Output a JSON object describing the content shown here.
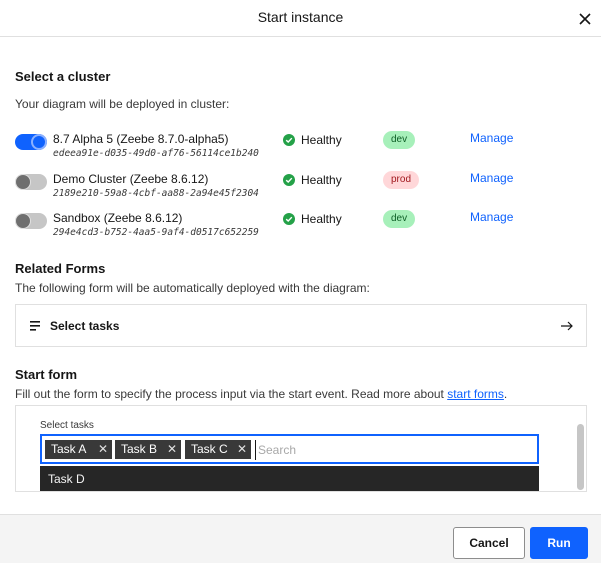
{
  "modal": {
    "title": "Start instance"
  },
  "cluster_section": {
    "title": "Select a cluster",
    "description": "Your diagram will be deployed in cluster:",
    "clusters": [
      {
        "name": "8.7 Alpha 5 (Zeebe 8.7.0-alpha5)",
        "id": "edeea91e-d035-49d0-af76-56114ce1b240",
        "status": "Healthy",
        "tag": "dev",
        "manage": "Manage",
        "selected": true
      },
      {
        "name": "Demo Cluster (Zeebe 8.6.12)",
        "id": "2189e210-59a8-4cbf-aa88-2a94e45f2304",
        "status": "Healthy",
        "tag": "prod",
        "manage": "Manage",
        "selected": false
      },
      {
        "name": "Sandbox (Zeebe 8.6.12)",
        "id": "294e4cd3-b752-4aa5-9af4-d0517c652259",
        "status": "Healthy",
        "tag": "dev",
        "manage": "Manage",
        "selected": false
      }
    ]
  },
  "related_forms": {
    "title": "Related Forms",
    "description": "The following form will be automatically deployed with the diagram:",
    "form_label": "Select tasks"
  },
  "start_form": {
    "title": "Start form",
    "description_prefix": "Fill out the form to specify the process input via the start event. Read more about ",
    "link": "start forms",
    "description_suffix": ".",
    "field_label": "Select tasks",
    "chips": [
      "Task A",
      "Task B",
      "Task C"
    ],
    "search_placeholder": "Search",
    "dropdown_option": "Task D"
  },
  "footer": {
    "cancel": "Cancel",
    "run": "Run"
  },
  "colors": {
    "accent": "#0f62fe",
    "success": "#24a148",
    "dev_tag": "#a7f0ba",
    "prod_tag": "#ffd7d9"
  },
  "icons": {
    "close": "close-icon",
    "status": "checkmark-filled-icon",
    "form": "list-icon",
    "arrow": "arrow-right-icon"
  }
}
